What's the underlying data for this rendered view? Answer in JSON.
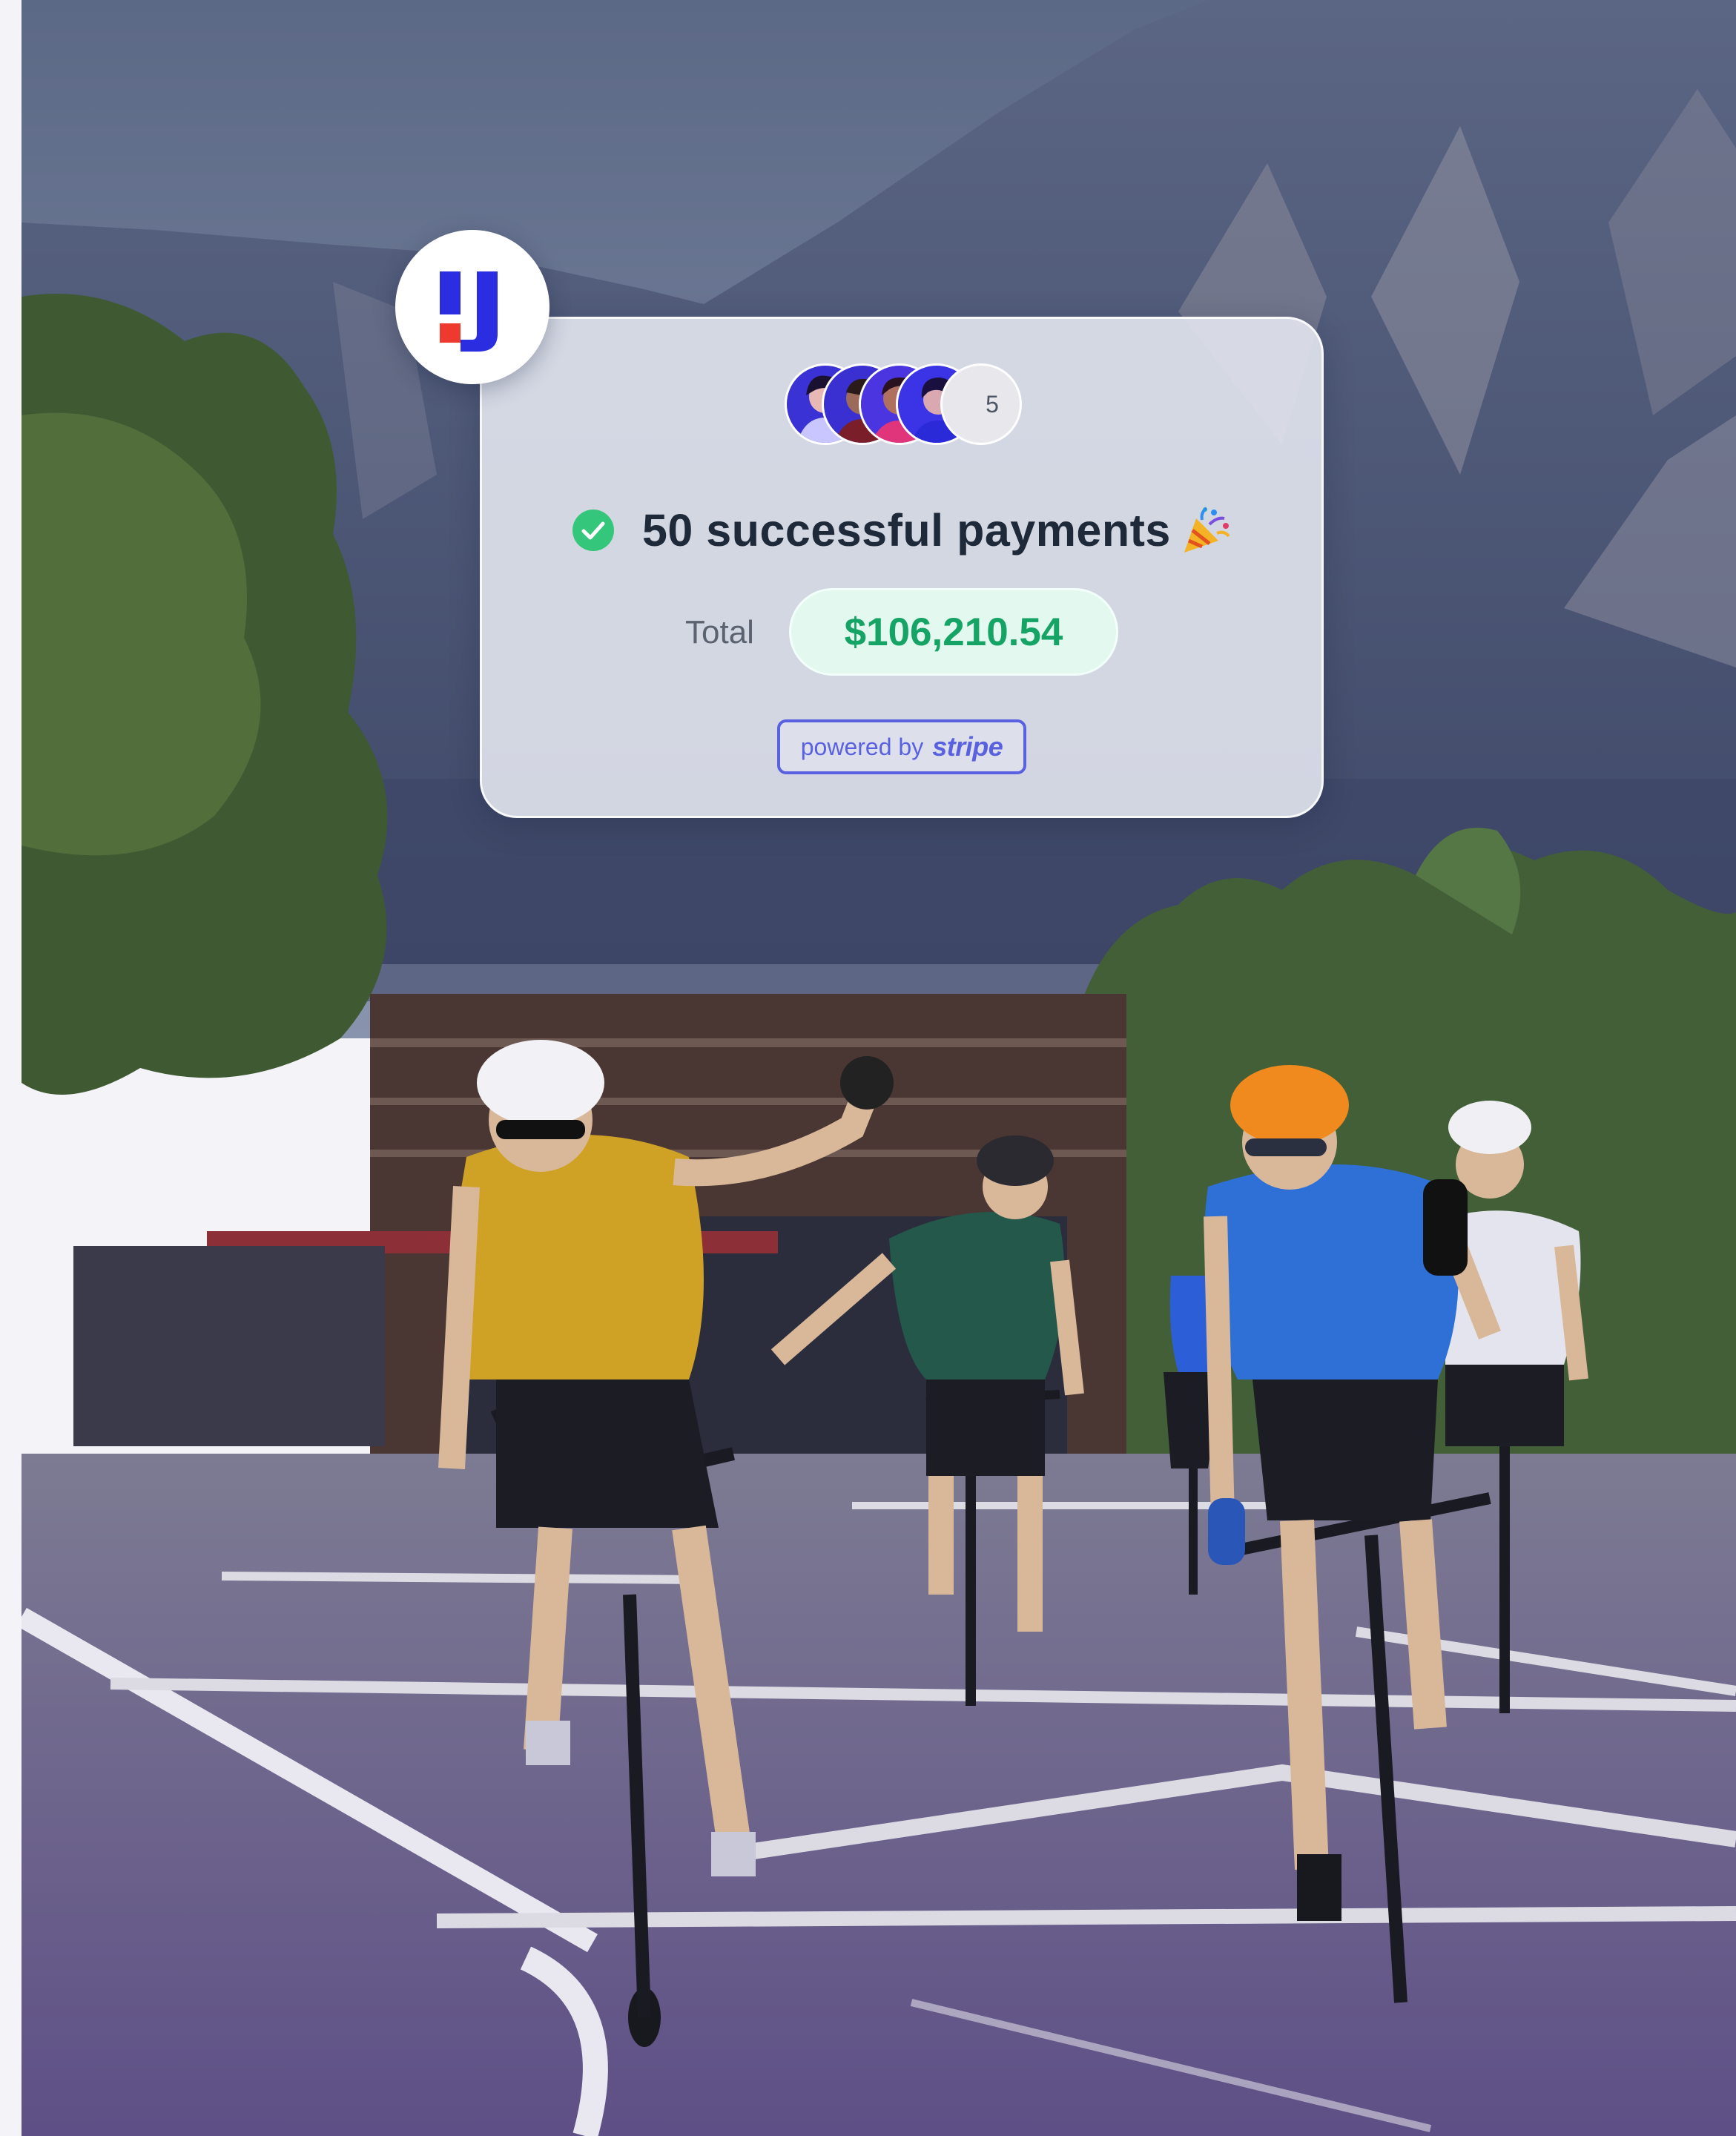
{
  "card": {
    "headline": "50 successful payments",
    "total_label": "Total",
    "total_amount": "$106,210.54",
    "avatar_overflow_count": "5",
    "powered_by_label": "powered by",
    "provider_name": "stripe"
  },
  "icons": {
    "brand_logo": "brand-logo-icon",
    "success": "check-circle-icon",
    "celebration": "party-popper-icon"
  },
  "colors": {
    "brand_blue": "#2b2ee0",
    "brand_red": "#ee3a2e",
    "success_green": "#34c77b",
    "amount_green": "#16a466",
    "stripe_purple": "#5a61e0",
    "headline": "#1e2939"
  }
}
